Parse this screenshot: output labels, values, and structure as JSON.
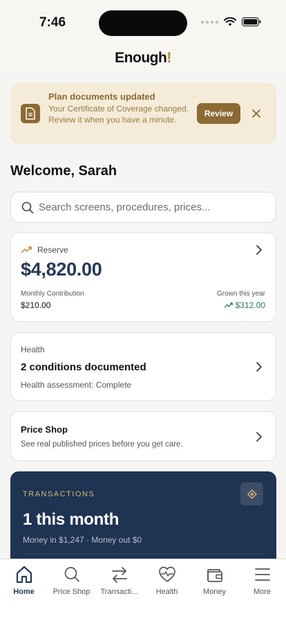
{
  "status_bar": {
    "time": "7:46"
  },
  "header": {
    "logo": "Enough",
    "logo_mark": "!"
  },
  "banner": {
    "title": "Plan documents updated",
    "message": "Your Certificate of Coverage changed. Review it when you have a minute.",
    "review_label": "Review",
    "icon": "document-icon"
  },
  "welcome": "Welcome, Sarah",
  "search": {
    "placeholder": "Search screens, procedures, prices..."
  },
  "reserve": {
    "label": "Reserve",
    "amount": "$4,820.00",
    "contribution_label": "Monthly Contribution",
    "contribution_value": "$210.00",
    "grown_label": "Grown this year",
    "grown_value": "$312.00"
  },
  "health": {
    "kicker": "Health",
    "title": "2 conditions documented",
    "subtitle": "Health assessment: Complete"
  },
  "price_shop": {
    "title": "Price Shop",
    "subtitle": "See real published prices before you get care."
  },
  "transactions": {
    "kicker": "TRANSACTIONS",
    "title": "1 this month",
    "subtitle": "Money in $1,247 · Money out $0"
  },
  "tabs": [
    {
      "label": "Home",
      "icon": "home-icon",
      "active": true
    },
    {
      "label": "Price Shop",
      "icon": "search-icon",
      "active": false
    },
    {
      "label": "Transacti...",
      "icon": "transfer-arrows-icon",
      "active": false
    },
    {
      "label": "Health",
      "icon": "heart-pulse-icon",
      "active": false
    },
    {
      "label": "Money",
      "icon": "wallet-icon",
      "active": false
    },
    {
      "label": "More",
      "icon": "menu-icon",
      "active": false
    }
  ],
  "colors": {
    "accent_gold": "#8b6a34",
    "navy": "#27385a",
    "card_navy": "#1f3352",
    "positive_green": "#2c7a55",
    "banner_bg": "#f4ebd8"
  }
}
